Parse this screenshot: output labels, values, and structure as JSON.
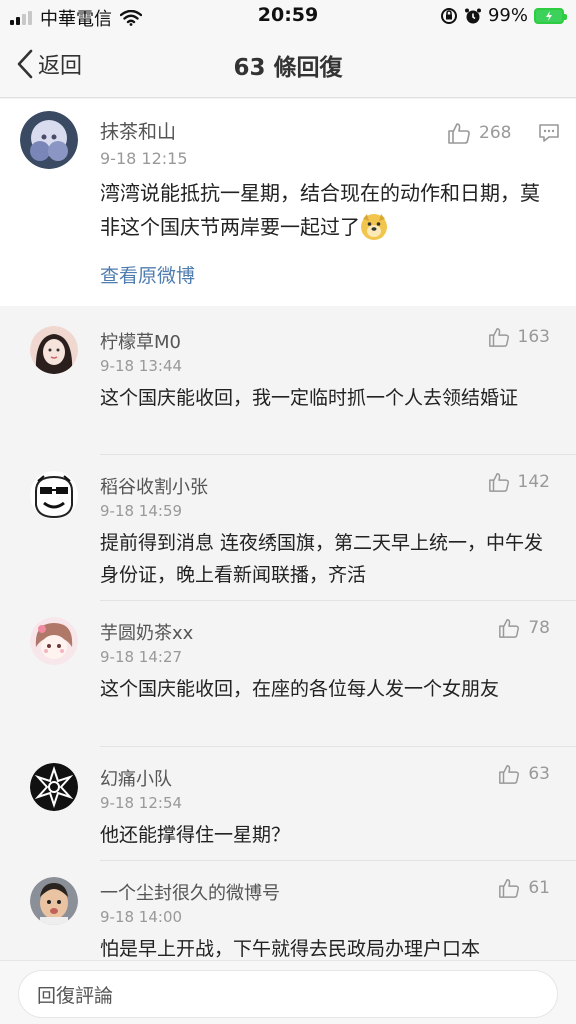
{
  "status_bar": {
    "carrier": "中華電信",
    "time": "20:59",
    "battery": "99%"
  },
  "nav": {
    "back_label": "返回",
    "title": "63 條回復"
  },
  "main_comment": {
    "user": "抹茶和山",
    "time": "9-18 12:15",
    "likes": "268",
    "text": "湾湾说能抵抗一星期，结合现在的动作和日期，莫非这个国庆节两岸要一起过了",
    "view_original": "查看原微博"
  },
  "replies": [
    {
      "user": "柠檬草M0",
      "time": "9-18 13:44",
      "likes": "163",
      "text": "这个国庆能收回，我一定临时抓一个人去领结婚证"
    },
    {
      "user": "稻谷收割小张",
      "time": "9-18 14:59",
      "likes": "142",
      "text": "提前得到消息 连夜绣国旗，第二天早上统一，中午发身份证，晚上看新闻联播，齐活"
    },
    {
      "user": "芋圆奶茶xx",
      "time": "9-18 14:27",
      "likes": "78",
      "text": "这个国庆能收回，在座的各位每人发一个女朋友"
    },
    {
      "user": "幻痛小队",
      "time": "9-18 12:54",
      "likes": "63",
      "text": "他还能撑得住一星期？"
    },
    {
      "user": "一个尘封很久的微博号",
      "time": "9-18 14:00",
      "likes": "61",
      "text": "怕是早上开战，下午就得去民政局办理户口本"
    }
  ],
  "comment_bar": {
    "placeholder": "回復評論"
  },
  "colors": {
    "link": "#507daf",
    "battery": "#3bd15a"
  }
}
